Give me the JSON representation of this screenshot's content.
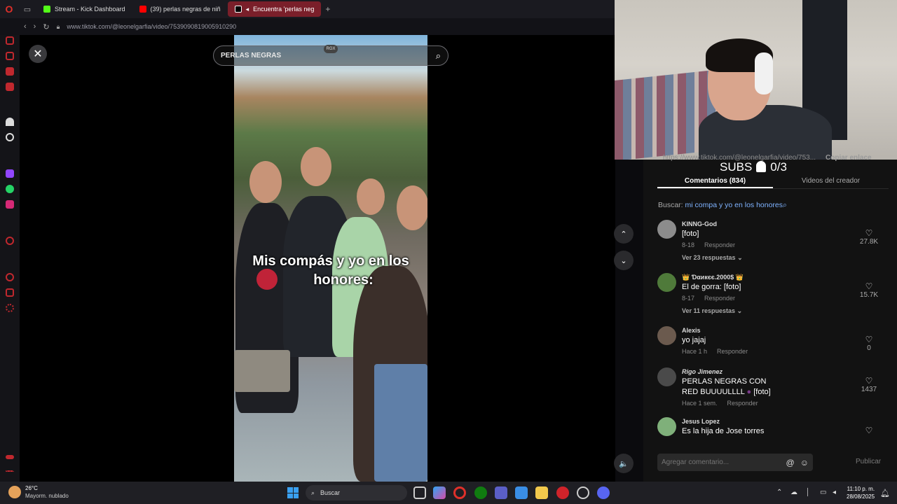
{
  "browser": {
    "tabs": [
      {
        "label": "Stream - Kick Dashboard",
        "color": "#53fc18"
      },
      {
        "label": "(39) perlas negras de niñ",
        "color": "#ff0000"
      },
      {
        "label": "Encuentra 'perlas neg",
        "color": "#ffffff",
        "active": true
      }
    ],
    "url": "www.tiktok.com/@leonelgarfia/video/7539090819005910290"
  },
  "video": {
    "search_value": "PERLAS NEGRAS",
    "rgx_badge": "RGX",
    "caption_line1": "Mis compás y yo en los",
    "caption_line2": "honores:"
  },
  "stream_overlay": {
    "url_faded": "https://www.tiktok.com/@leonelgarfia/video/753...",
    "copy_link": "Copiar enlace",
    "subs_label": "SUBS",
    "subs_count": "0/3"
  },
  "comments_panel": {
    "tab_comments": "Comentarios (834)",
    "tab_creator": "Videos del creador",
    "search_prefix": "Buscar:",
    "search_link": "mi compa y yo en los honores",
    "items": [
      {
        "name": "KINNG-God",
        "text": "[foto]",
        "date": "8-18",
        "reply": "Responder",
        "replies": "Ver 23 respuestas",
        "likes": "27.8K",
        "avatar_color": "#8c8c8c"
      },
      {
        "name": "Ɗαикєє.2000$",
        "text": "El de gorra: [foto]",
        "date": "8-17",
        "reply": "Responder",
        "replies": "Ver 11 respuestas",
        "likes": "15.7K",
        "avatar_color": "#4f7a3a"
      },
      {
        "name": "Alexis",
        "text": "yo jajaj",
        "date": "Hace 1 h",
        "reply": "Responder",
        "likes": "0",
        "avatar_color": "#6b5a4e"
      },
      {
        "name": "Rigo Jimenez",
        "text_line1": "PERLAS NEGRAS CON",
        "text_line2": "RED BUUUULLLL",
        "text_extra": "[foto]",
        "date": "Hace 1 sem.",
        "reply": "Responder",
        "likes": "1437",
        "avatar_color": "#4a4a4a"
      },
      {
        "name": "Jesus Lopez",
        "text": "Es la hija de Jose torres",
        "avatar_color": "#7fb07a"
      }
    ],
    "input_placeholder": "Agregar comentario...",
    "publish": "Publicar"
  },
  "taskbar": {
    "temp": "26°C",
    "weather_desc": "Mayorm. nublado",
    "search_label": "Buscar",
    "time": "11:10 p. m.",
    "date": "28/08/2025"
  },
  "icons": {
    "close": "✕",
    "search": "⌕",
    "up": "⌃",
    "down": "⌄",
    "volume": "🔈",
    "heart": "♡",
    "at": "@",
    "emoji": "☺"
  }
}
